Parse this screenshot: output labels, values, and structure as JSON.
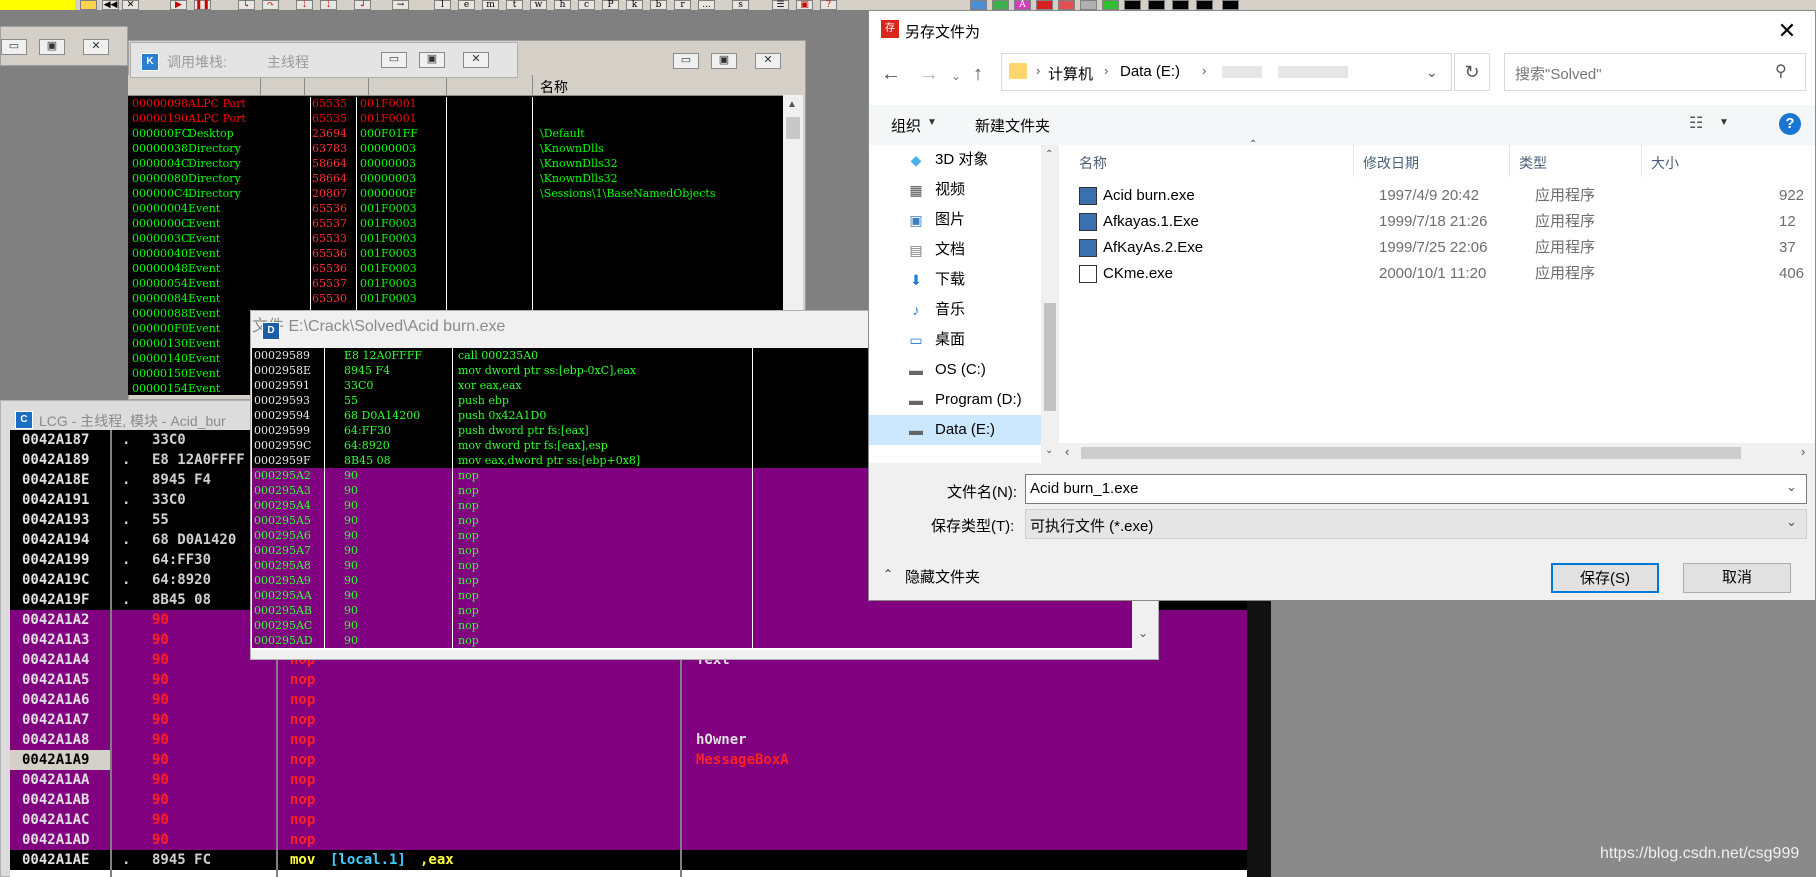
{
  "toolbar": {
    "buttons": [
      "l",
      "e",
      "m",
      "t",
      "w",
      "h",
      "c",
      "P",
      "k",
      "b",
      "r",
      "...",
      "s"
    ]
  },
  "handles_window": {
    "title": "调用堆栈:",
    "subtitle": "主线程",
    "columns": {
      "name": "名称"
    },
    "rows": [
      {
        "handle": "00000098",
        "type": "ALPC Port",
        "count": "65535",
        "access": "001F0001",
        "name": "",
        "color": "#ff0000"
      },
      {
        "handle": "00000190",
        "type": "ALPC Port",
        "count": "65535",
        "access": "001F0001",
        "name": "",
        "color": "#ff0000"
      },
      {
        "handle": "000000FC",
        "type": "Desktop",
        "count": "23694",
        "access": "000F01FF",
        "name": "\\Default",
        "color": "#00ff00"
      },
      {
        "handle": "00000038",
        "type": "Directory",
        "count": "63783",
        "access": "00000003",
        "name": "\\KnownDlls",
        "color": "#00ff00"
      },
      {
        "handle": "0000004C",
        "type": "Directory",
        "count": "58664",
        "access": "00000003",
        "name": "\\KnownDlls32",
        "color": "#00ff00"
      },
      {
        "handle": "00000080",
        "type": "Directory",
        "count": "58664",
        "access": "00000003",
        "name": "\\KnownDlls32",
        "color": "#00ff00"
      },
      {
        "handle": "000000C4",
        "type": "Directory",
        "count": "20807",
        "access": "0000000F",
        "name": "\\Sessions\\1\\BaseNamedObjects",
        "color": "#00ff00"
      },
      {
        "handle": "00000004",
        "type": "Event",
        "count": "65536",
        "access": "001F0003",
        "name": "",
        "color": "#00ff00"
      },
      {
        "handle": "0000000C",
        "type": "Event",
        "count": "65537",
        "access": "001F0003",
        "name": "",
        "color": "#00ff00"
      },
      {
        "handle": "0000003C",
        "type": "Event",
        "count": "65533",
        "access": "001F0003",
        "name": "",
        "color": "#00ff00"
      },
      {
        "handle": "00000040",
        "type": "Event",
        "count": "65536",
        "access": "001F0003",
        "name": "",
        "color": "#00ff00"
      },
      {
        "handle": "00000048",
        "type": "Event",
        "count": "65536",
        "access": "001F0003",
        "name": "",
        "color": "#00ff00"
      },
      {
        "handle": "00000054",
        "type": "Event",
        "count": "65537",
        "access": "001F0003",
        "name": "",
        "color": "#00ff00"
      },
      {
        "handle": "00000084",
        "type": "Event",
        "count": "65530",
        "access": "001F0003",
        "name": "",
        "color": "#00ff00"
      },
      {
        "handle": "00000088",
        "type": "Event",
        "count": "",
        "access": "",
        "name": "",
        "color": "#00ff00"
      },
      {
        "handle": "000000F0",
        "type": "Event",
        "count": "",
        "access": "",
        "name": "",
        "color": "#00ff00"
      },
      {
        "handle": "00000130",
        "type": "Event",
        "count": "",
        "access": "",
        "name": "",
        "color": "#00ff00"
      },
      {
        "handle": "00000140",
        "type": "Event",
        "count": "",
        "access": "",
        "name": "",
        "color": "#00ff00"
      },
      {
        "handle": "00000150",
        "type": "Event",
        "count": "",
        "access": "",
        "name": "",
        "color": "#00ff00"
      },
      {
        "handle": "00000154",
        "type": "Event",
        "count": "",
        "access": "",
        "name": "",
        "color": "#00ff00"
      }
    ]
  },
  "lcg_window": {
    "title": "LCG - 主线程, 模块 - Acid_bur",
    "rows": [
      {
        "addr": "0042A187",
        "mark": ".",
        "hex": "33C0",
        "asm": "",
        "cmt": ""
      },
      {
        "addr": "0042A189",
        "mark": ".",
        "hex": "E8 12A0FFFF",
        "asm": "",
        "cmt": ""
      },
      {
        "addr": "0042A18E",
        "mark": ".",
        "hex": "8945 F4",
        "asm": "",
        "cmt": ""
      },
      {
        "addr": "0042A191",
        "mark": ".",
        "hex": "33C0",
        "asm": "",
        "cmt": ""
      },
      {
        "addr": "0042A193",
        "mark": ".",
        "hex": "55",
        "asm": "",
        "cmt": ""
      },
      {
        "addr": "0042A194",
        "mark": ".",
        "hex": "68 D0A1420",
        "asm": "",
        "cmt": ""
      },
      {
        "addr": "0042A199",
        "mark": ".",
        "hex": "64:FF30",
        "asm": "",
        "cmt": ""
      },
      {
        "addr": "0042A19C",
        "mark": ".",
        "hex": "64:8920",
        "asm": "",
        "cmt": ""
      },
      {
        "addr": "0042A19F",
        "mark": ".",
        "hex": "8B45 08",
        "asm": "",
        "cmt": ""
      },
      {
        "addr": "0042A1A2",
        "mark": "",
        "hex": "90",
        "asm": "",
        "cmt": ""
      },
      {
        "addr": "0042A1A3",
        "mark": "",
        "hex": "90",
        "asm": "",
        "cmt": ""
      },
      {
        "addr": "0042A1A4",
        "mark": "",
        "hex": "90",
        "asm": "nop",
        "cmt": "Text"
      },
      {
        "addr": "0042A1A5",
        "mark": "",
        "hex": "90",
        "asm": "nop",
        "cmt": ""
      },
      {
        "addr": "0042A1A6",
        "mark": "",
        "hex": "90",
        "asm": "nop",
        "cmt": ""
      },
      {
        "addr": "0042A1A7",
        "mark": "",
        "hex": "90",
        "asm": "nop",
        "cmt": ""
      },
      {
        "addr": "0042A1A8",
        "mark": "",
        "hex": "90",
        "asm": "nop",
        "cmt": "hOwner"
      },
      {
        "addr": "0042A1A9",
        "mark": "",
        "hex": "90",
        "asm": "nop",
        "cmt": "MessageBoxA"
      },
      {
        "addr": "0042A1AA",
        "mark": "",
        "hex": "90",
        "asm": "nop",
        "cmt": ""
      },
      {
        "addr": "0042A1AB",
        "mark": "",
        "hex": "90",
        "asm": "nop",
        "cmt": ""
      },
      {
        "addr": "0042A1AC",
        "mark": "",
        "hex": "90",
        "asm": "nop",
        "cmt": ""
      },
      {
        "addr": "0042A1AD",
        "mark": "",
        "hex": "90",
        "asm": "nop",
        "cmt": ""
      },
      {
        "addr": "0042A1AE",
        "mark": ".",
        "hex": "8945 FC",
        "asm": "mov",
        "asm2": "[local.1]",
        "asm3": ",eax",
        "cmt": ""
      }
    ]
  },
  "file_window": {
    "title": "文件 E:\\Crack\\Solved\\Acid burn.exe",
    "rows": [
      {
        "addr": "00029589",
        "hex": "E8 12A0FFFF",
        "asm": "call 000235A0"
      },
      {
        "addr": "0002958E",
        "hex": "8945 F4",
        "asm": "mov dword ptr ss:[ebp-0xC],eax"
      },
      {
        "addr": "00029591",
        "hex": "33C0",
        "asm": "xor eax,eax"
      },
      {
        "addr": "00029593",
        "hex": "55",
        "asm": "push ebp"
      },
      {
        "addr": "00029594",
        "hex": "68 D0A14200",
        "asm": "push 0x42A1D0"
      },
      {
        "addr": "00029599",
        "hex": "64:FF30",
        "asm": "push dword ptr fs:[eax]"
      },
      {
        "addr": "0002959C",
        "hex": "64:8920",
        "asm": "mov dword ptr fs:[eax],esp"
      },
      {
        "addr": "0002959F",
        "hex": "8B45 08",
        "asm": "mov eax,dword ptr ss:[ebp+0x8]"
      },
      {
        "addr": "000295A2",
        "hex": "90",
        "asm": "nop"
      },
      {
        "addr": "000295A3",
        "hex": "90",
        "asm": "nop"
      },
      {
        "addr": "000295A4",
        "hex": "90",
        "asm": "nop"
      },
      {
        "addr": "000295A5",
        "hex": "90",
        "asm": "nop"
      },
      {
        "addr": "000295A6",
        "hex": "90",
        "asm": "nop"
      },
      {
        "addr": "000295A7",
        "hex": "90",
        "asm": "nop"
      },
      {
        "addr": "000295A8",
        "hex": "90",
        "asm": "nop"
      },
      {
        "addr": "000295A9",
        "hex": "90",
        "asm": "nop"
      },
      {
        "addr": "000295AA",
        "hex": "90",
        "asm": "nop"
      },
      {
        "addr": "000295AB",
        "hex": "90",
        "asm": "nop"
      },
      {
        "addr": "000295AC",
        "hex": "90",
        "asm": "nop"
      },
      {
        "addr": "000295AD",
        "hex": "90",
        "asm": "nop"
      }
    ]
  },
  "save_dialog": {
    "title": "另存文件为",
    "path": [
      "计算机",
      "Data (E:)"
    ],
    "search_placeholder": "搜索\"Solved\"",
    "organize": "组织",
    "new_folder": "新建文件夹",
    "help": "?",
    "columns": {
      "name": "名称",
      "date": "修改日期",
      "type": "类型",
      "size": "大小"
    },
    "nav": [
      {
        "icon": "3d-objects-icon",
        "label": "3D 对象"
      },
      {
        "icon": "videos-icon",
        "label": "视频"
      },
      {
        "icon": "pictures-icon",
        "label": "图片"
      },
      {
        "icon": "documents-icon",
        "label": "文档"
      },
      {
        "icon": "downloads-icon",
        "label": "下载"
      },
      {
        "icon": "music-icon",
        "label": "音乐"
      },
      {
        "icon": "desktop-icon",
        "label": "桌面"
      },
      {
        "icon": "drive-icon",
        "label": "OS (C:)"
      },
      {
        "icon": "drive-icon",
        "label": "Program (D:)"
      },
      {
        "icon": "drive-icon",
        "label": "Data (E:)"
      }
    ],
    "files": [
      {
        "name": "Acid burn.exe",
        "date": "1997/4/9 20:42",
        "type": "应用程序",
        "size": "922"
      },
      {
        "name": "Afkayas.1.Exe",
        "date": "1999/7/18 21:26",
        "type": "应用程序",
        "size": "12"
      },
      {
        "name": "AfKayAs.2.Exe",
        "date": "1999/7/25 22:06",
        "type": "应用程序",
        "size": "37"
      },
      {
        "name": "CKme.exe",
        "date": "2000/10/1 11:20",
        "type": "应用程序",
        "size": "406"
      }
    ],
    "filename_label": "文件名(N):",
    "filename_value": "Acid burn_1.exe",
    "filetype_label": "保存类型(T):",
    "filetype_value": "可执行文件 (*.exe)",
    "hide_folders": "隐藏文件夹",
    "save": "保存(S)",
    "cancel": "取消"
  },
  "watermark": "https://blog.csdn.net/csg999"
}
